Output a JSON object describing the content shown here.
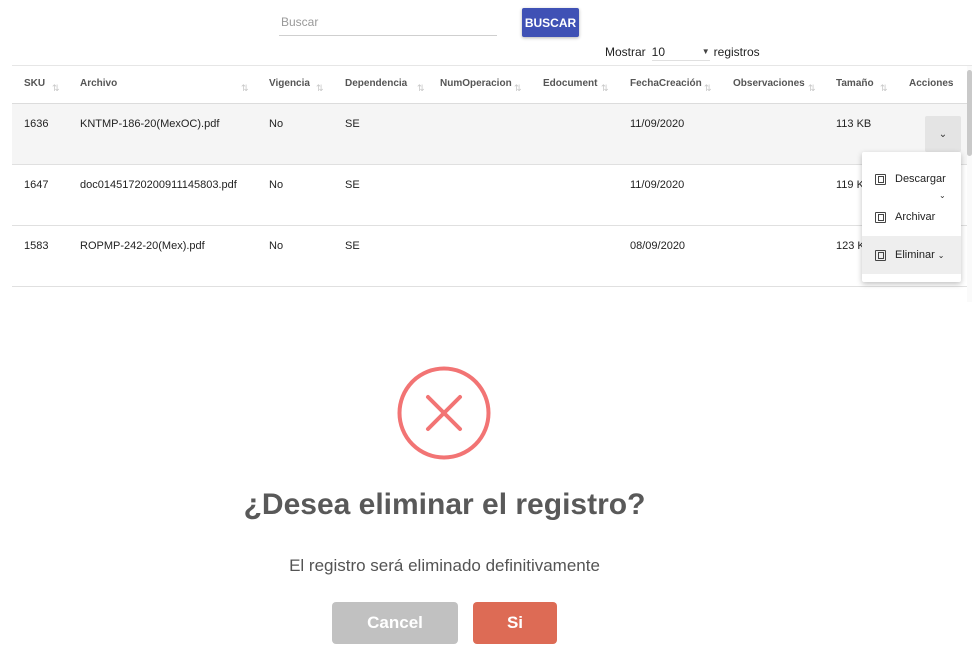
{
  "toolbar": {
    "search_placeholder": "Buscar",
    "search_value": "",
    "search_button": "BUSCAR",
    "show_prefix": "Mostrar",
    "show_value": "10",
    "show_suffix": "registros"
  },
  "table": {
    "columns": [
      "SKU",
      "Archivo",
      "Vigencia",
      "Dependencia",
      "NumOperacion",
      "Edocument",
      "FechaCreación",
      "Observaciones",
      "Tamaño",
      "Acciones"
    ],
    "rows": [
      {
        "sku": "1636",
        "archivo": "KNTMP-186-20(MexOC).pdf",
        "vigencia": "No",
        "dependencia": "SE",
        "fecha": "11/09/2020",
        "tamano": "113 KB"
      },
      {
        "sku": "1647",
        "archivo": "doc01451720200911145803.pdf",
        "vigencia": "No",
        "dependencia": "SE",
        "fecha": "11/09/2020",
        "tamano": "119 KB"
      },
      {
        "sku": "1583",
        "archivo": "ROPMP-242-20(Mex).pdf",
        "vigencia": "No",
        "dependencia": "SE",
        "fecha": "08/09/2020",
        "tamano": "123 KB"
      }
    ],
    "actions_toggle_icon": "chevron-down-icon"
  },
  "menu": {
    "items": [
      {
        "label": "Descargar",
        "icon": "copy-icon"
      },
      {
        "label": "Archivar",
        "icon": "archive-icon"
      },
      {
        "label": "Eliminar",
        "icon": "delete-icon"
      }
    ]
  },
  "dialog": {
    "icon": "error-x-icon",
    "title": "¿Desea eliminar el registro?",
    "text": "El registro será eliminado definitivamente",
    "cancel_label": "Cancel",
    "confirm_label": "Si",
    "colors": {
      "error": "#f27474",
      "confirm": "#dd6b55",
      "cancel": "#c1c1c1",
      "primary": "#3f51b5"
    }
  }
}
